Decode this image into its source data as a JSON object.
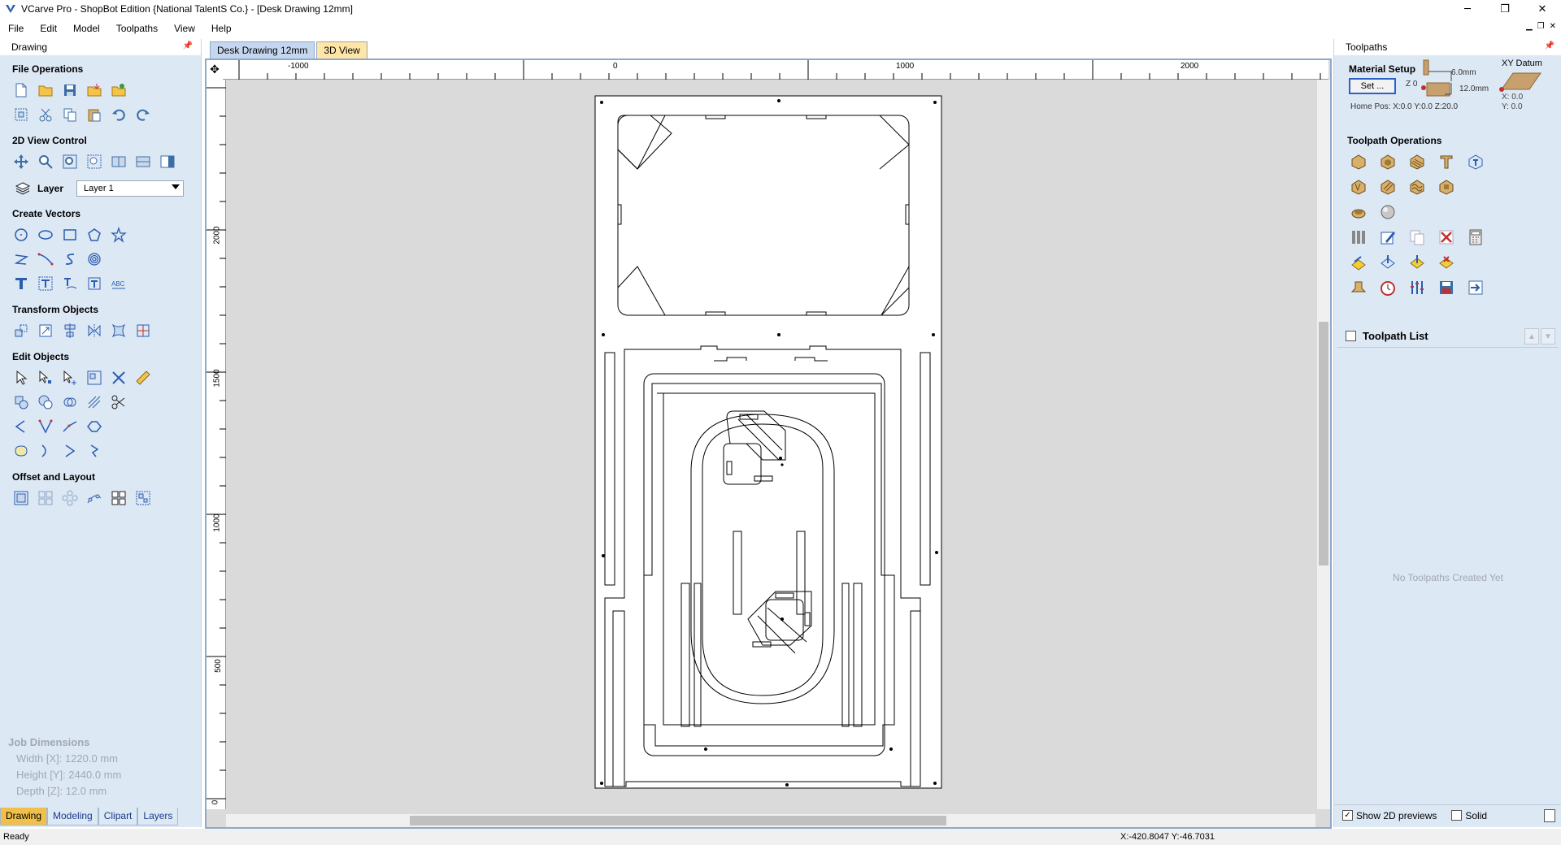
{
  "window": {
    "title": "VCarve Pro - ShopBot Edition {National TalentS Co.} - [Desk Drawing 12mm]",
    "minimize": "─",
    "maximize": "❐",
    "close": "✕"
  },
  "menu": {
    "items": [
      "File",
      "Edit",
      "Model",
      "Toolpaths",
      "View",
      "Help"
    ],
    "mdi_minimize": "▁",
    "mdi_restore": "❐",
    "mdi_close": "✕"
  },
  "left_panel": {
    "header": "Drawing",
    "sections": {
      "file_operations": "File Operations",
      "view_control": "2D View Control",
      "create_vectors": "Create Vectors",
      "transform_objects": "Transform Objects",
      "edit_objects": "Edit Objects",
      "offset_layout": "Offset and Layout"
    },
    "layer_label": "Layer",
    "layer_value": "Layer 1",
    "job_dimensions": {
      "title": "Job Dimensions",
      "width": "Width  [X]: 1220.0 mm",
      "height": "Height [Y]: 2440.0 mm",
      "depth": "Depth  [Z]: 12.0 mm"
    },
    "tabs": [
      "Drawing",
      "Modeling",
      "Clipart",
      "Layers"
    ],
    "active_tab": "Drawing"
  },
  "document": {
    "tabs": [
      "Desk Drawing 12mm",
      "3D View"
    ],
    "active_tab": "Desk Drawing 12mm",
    "ruler_x_labels": [
      "-1000",
      "0",
      "1000",
      "2000"
    ],
    "ruler_y_labels": [
      "2000",
      "1500",
      "1000",
      "500",
      "0"
    ]
  },
  "right_panel": {
    "header": "Toolpaths",
    "material_setup": {
      "title": "Material Setup",
      "set_button": "Set ...",
      "thickness_top": "6.0mm",
      "thickness_total": "12.0mm",
      "z_label": "Z 0",
      "home_pos": "Home Pos:  X:0.0 Y:0.0 Z:20.0",
      "xy_datum": "XY Datum",
      "xy_x": "X: 0.0",
      "xy_y": "Y: 0.0"
    },
    "toolpath_operations": "Toolpath Operations",
    "toolpath_list": "Toolpath List",
    "empty_message": "No Toolpaths Created Yet",
    "show_previews": "Show 2D previews",
    "show_previews_checked": true,
    "solid": "Solid",
    "solid_checked": false
  },
  "status": {
    "text": "Ready",
    "coords": "X:-420.8047 Y:-46.7031"
  }
}
